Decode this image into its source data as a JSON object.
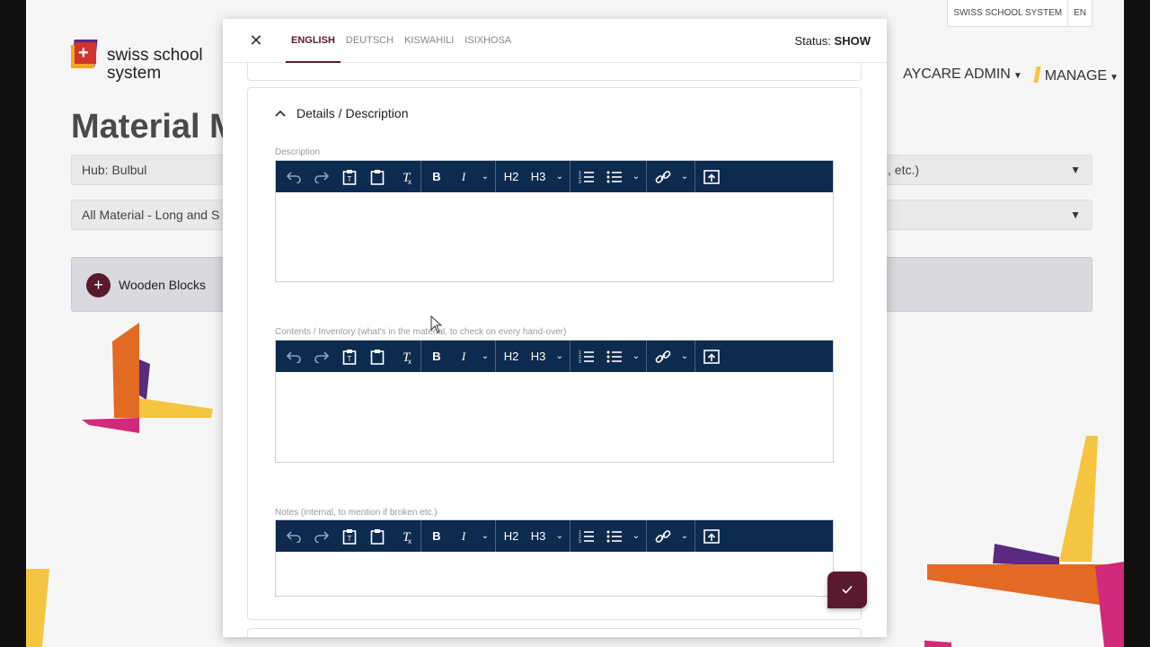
{
  "topbar": {
    "school": "SWISS SCHOOL SYSTEM",
    "lang": "EN"
  },
  "logo": {
    "line1": "swiss school",
    "line2": "system"
  },
  "page": {
    "title": "Material M"
  },
  "nav": {
    "daycare": "AYCARE ADMIN",
    "manage": "MANAGE"
  },
  "filters": [
    {
      "value": "Hub: Bulbul",
      "tail": ", etc.)"
    },
    {
      "value": "All Material - Long and S",
      "tail": ""
    }
  ],
  "card": {
    "label": "Wooden Blocks"
  },
  "modal": {
    "tabs": [
      "ENGLISH",
      "DEUTSCH",
      "KISWAHILI",
      "ISIXHOSA"
    ],
    "status_label": "Status:",
    "status_value": "SHOW",
    "section_title": "Details / Description",
    "fields": [
      {
        "label": "Description"
      },
      {
        "label": "Contents / Inventory (what's in the material, to check on every hand-over)"
      },
      {
        "label": "Notes (internal, to mention if broken etc.)"
      }
    ],
    "toolbar": {
      "h2": "H2",
      "h3": "H3",
      "bold": "B",
      "italic": "I"
    }
  },
  "colors": {
    "toolbar": "#0d2a4f",
    "accent": "#5a1a2e"
  }
}
